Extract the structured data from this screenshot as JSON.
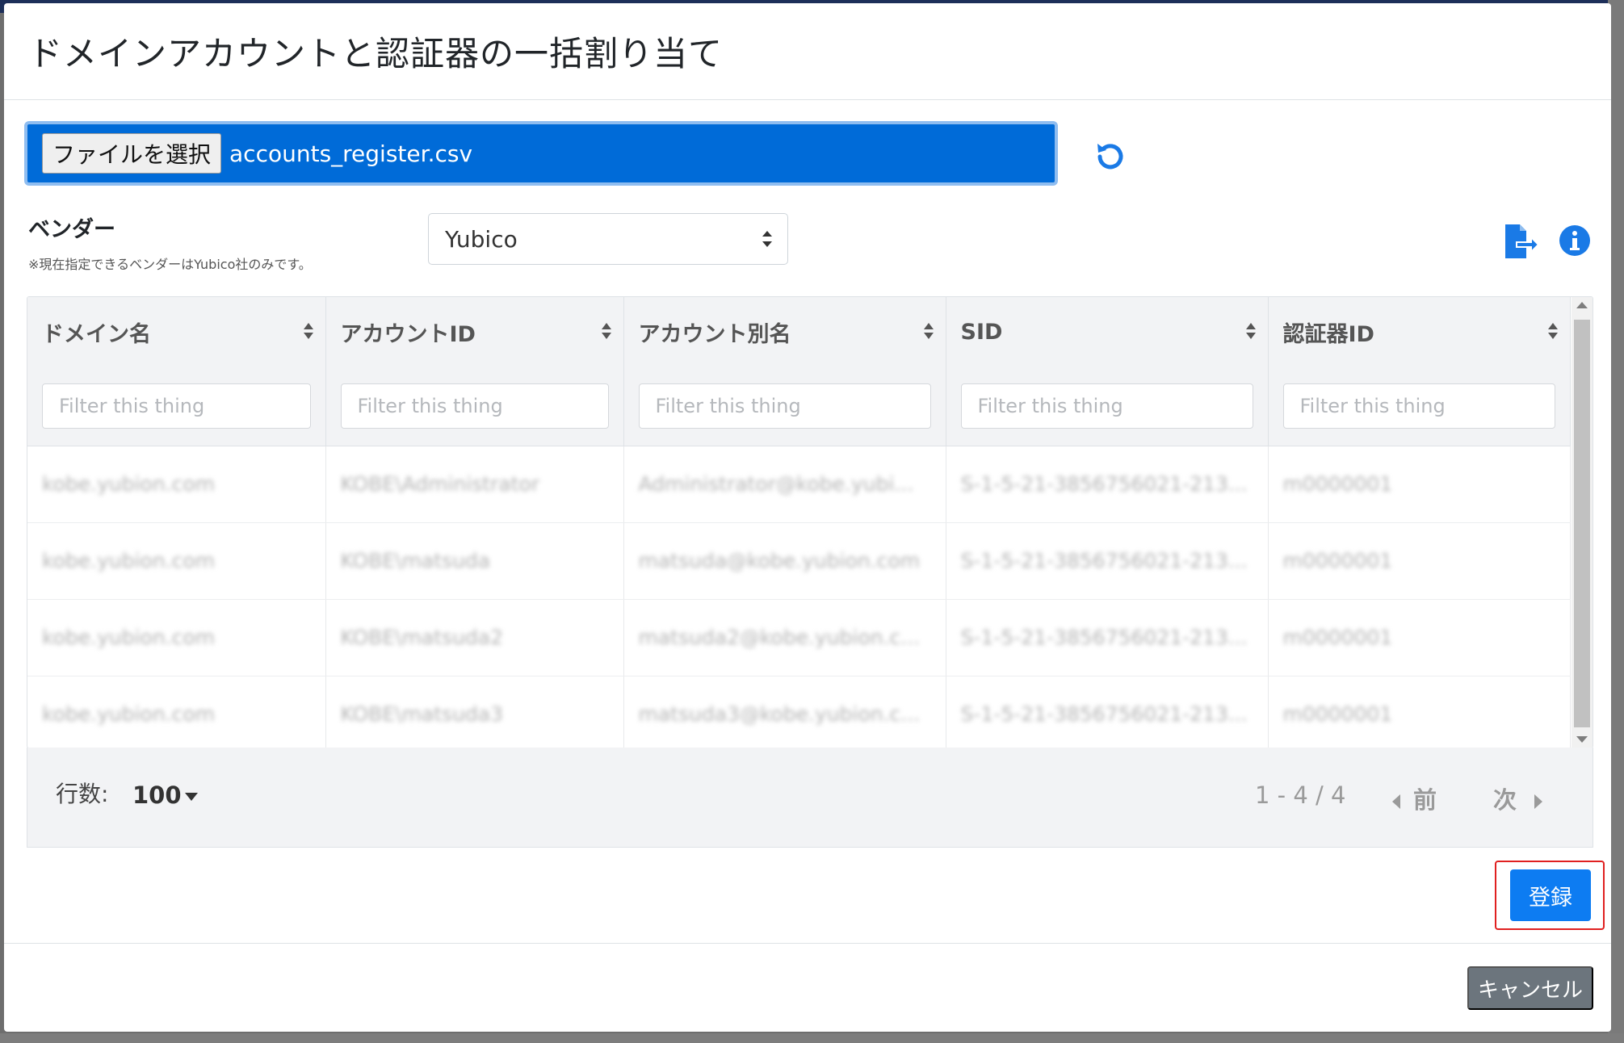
{
  "modal": {
    "title": "ドメインアカウントと認証器の一括割り当て"
  },
  "file": {
    "button_label": "ファイルを選択",
    "file_name": "accounts_register.csv"
  },
  "vendor": {
    "label": "ベンダー",
    "note": "※現在指定できるベンダーはYubico社のみです。",
    "selected": "Yubico"
  },
  "table": {
    "columns": [
      "ドメイン名",
      "アカウントID",
      "アカウント別名",
      "SID",
      "認証器ID"
    ],
    "filter_placeholder": "Filter this thing",
    "rows": [
      [
        "kobe.yubion.com",
        "KOBE\\Administrator",
        "Administrator@kobe.yubi...",
        "S-1-5-21-3856756021-213...",
        "m0000001"
      ],
      [
        "kobe.yubion.com",
        "KOBE\\matsuda",
        "matsuda@kobe.yubion.com",
        "S-1-5-21-3856756021-213...",
        "m0000001"
      ],
      [
        "kobe.yubion.com",
        "KOBE\\matsuda2",
        "matsuda2@kobe.yubion.c...",
        "S-1-5-21-3856756021-213...",
        "m0000001"
      ],
      [
        "kobe.yubion.com",
        "KOBE\\matsuda3",
        "matsuda3@kobe.yubion.c...",
        "S-1-5-21-3856756021-213...",
        "m0000001"
      ]
    ]
  },
  "pager": {
    "rows_label": "行数:",
    "rows_value": "100",
    "page_info": "1 - 4 / 4",
    "prev_label": "前",
    "next_label": "次"
  },
  "actions": {
    "register_label": "登録",
    "cancel_label": "キャンセル"
  },
  "colors": {
    "primary": "#0d7cf2",
    "file_box": "#006bd8",
    "highlight": "#e02020",
    "secondary": "#6c757d"
  },
  "icons": {
    "reset": "undo-icon",
    "export": "file-export-icon",
    "info": "info-icon",
    "sort": "sort-icon"
  }
}
